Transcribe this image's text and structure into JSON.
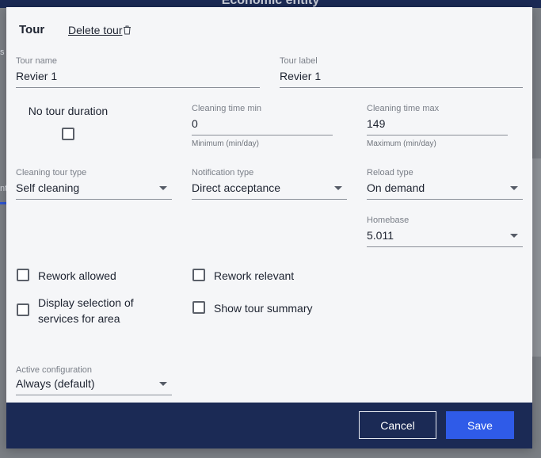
{
  "backdrop": {
    "title": "Economic entity",
    "left_letter": "s",
    "left_letter2": "nt"
  },
  "modal": {
    "title": "Tour",
    "delete_label": "Delete tour",
    "tour_name": {
      "label": "Tour name",
      "value": "Revier 1"
    },
    "tour_label": {
      "label": "Tour label",
      "value": "Revier 1"
    },
    "no_tour_duration": {
      "label": "No tour duration",
      "checked": false
    },
    "cleaning_time_min": {
      "label": "Cleaning time min",
      "value": "0",
      "help": "Minimum (min/day)"
    },
    "cleaning_time_max": {
      "label": "Cleaning time max",
      "value": "149",
      "help": "Maximum (min/day)"
    },
    "cleaning_tour_type": {
      "label": "Cleaning tour type",
      "value": "Self cleaning"
    },
    "notification_type": {
      "label": "Notification type",
      "value": "Direct acceptance"
    },
    "reload_type": {
      "label": "Reload type",
      "value": "On demand"
    },
    "homebase": {
      "label": "Homebase",
      "value": "5.011"
    },
    "checkboxes": {
      "rework_allowed": "Rework allowed",
      "rework_relevant": "Rework relevant",
      "display_selection": "Display selection of services for area",
      "show_tour_summary": "Show tour summary"
    },
    "active_configuration": {
      "label": "Active configuration",
      "value": "Always (default)"
    }
  },
  "footer": {
    "cancel_label": "Cancel",
    "save_label": "Save"
  },
  "colors": {
    "footer": "#1b2a55",
    "primary": "#2f5be8"
  },
  "icons": {
    "delete": "trash-icon",
    "select": "chevron-down-icon"
  }
}
